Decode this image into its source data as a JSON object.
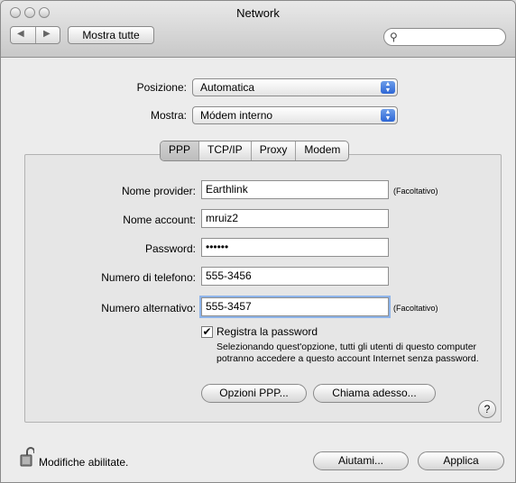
{
  "window": {
    "title": "Network"
  },
  "toolbar": {
    "show_all_label": "Mostra tutte",
    "search_placeholder": ""
  },
  "location": {
    "label": "Posizione:",
    "value": "Automatica"
  },
  "show": {
    "label": "Mostra:",
    "value": "Módem interno"
  },
  "tabs": [
    {
      "label": "PPP",
      "active": true
    },
    {
      "label": "TCP/IP",
      "active": false
    },
    {
      "label": "Proxy",
      "active": false
    },
    {
      "label": "Modem",
      "active": false
    }
  ],
  "form": {
    "provider": {
      "label": "Nome provider:",
      "value": "Earthlink",
      "hint": "(Facoltativo)"
    },
    "account": {
      "label": "Nome account:",
      "value": "mruiz2"
    },
    "password": {
      "label": "Password:",
      "value": "••••••"
    },
    "phone": {
      "label": "Numero di telefono:",
      "value": "555-3456"
    },
    "alt_phone": {
      "label": "Numero alternativo:",
      "value": "555-3457",
      "hint": "(Facoltativo)"
    },
    "save_password": {
      "label": "Registra la password",
      "checked": true,
      "description": "Selezionando quest'opzione, tutti gli utenti di questo computer potranno accedere a questo account Internet senza password."
    },
    "ppp_options_label": "Opzioni PPP...",
    "dial_now_label": "Chiama adesso...",
    "help_label": "?"
  },
  "footer": {
    "lock_text": "Modifiche abilitate.",
    "assist_label": "Aiutami...",
    "apply_label": "Applica"
  },
  "colors": {
    "focus_ring": "#8eb4ea",
    "popup_arrows": "#2d66d6"
  }
}
